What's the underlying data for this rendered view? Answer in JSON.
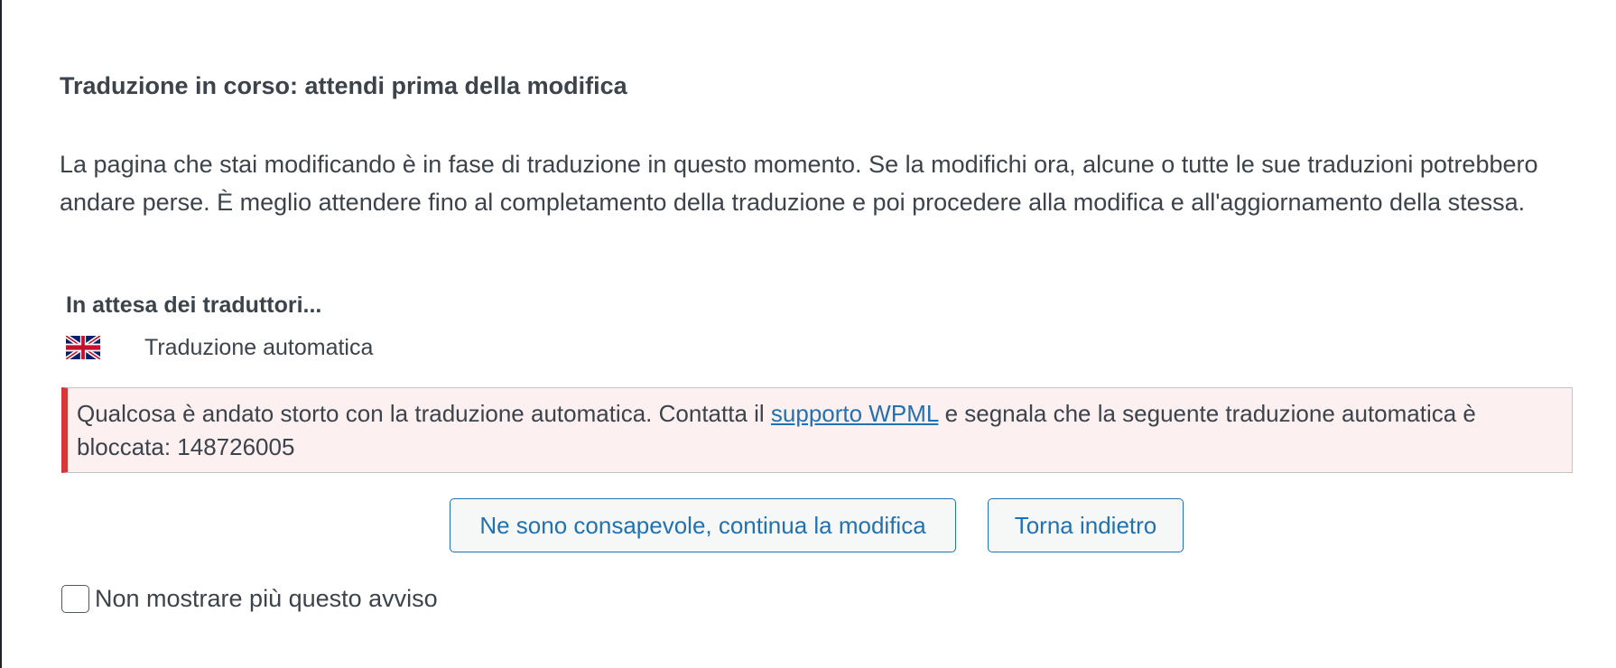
{
  "dialog": {
    "title": "Traduzione in corso: attendi prima della modifica",
    "message": "La pagina che stai modificando è in fase di traduzione in questo momento. Se la modifichi ora, alcune o tutte le sue traduzioni potrebbero andare perse. È meglio attendere fino al completamento della traduzione e poi procedere alla modifica e all'aggiornamento della stessa.",
    "waiting_heading": "In attesa dei traduttori...",
    "translators": [
      {
        "flag_icon": "uk-flag-icon",
        "label": "Traduzione automatica"
      }
    ],
    "error_notice": {
      "text_before": "Qualcosa è andato storto con la traduzione automatica. Contatta il ",
      "link_text": "supporto WPML",
      "text_after": " e segnala che la seguente traduzione automatica è bloccata: 148726005",
      "accent_color": "#d63638",
      "background_color": "#fcf0f1"
    },
    "buttons": {
      "continue_label": "Ne sono consapevole, continua la modifica",
      "back_label": "Torna indietro"
    },
    "checkbox": {
      "label": "Non mostrare più questo avviso",
      "checked": false
    },
    "colors": {
      "link": "#2271b1",
      "text": "#3c434a"
    }
  }
}
